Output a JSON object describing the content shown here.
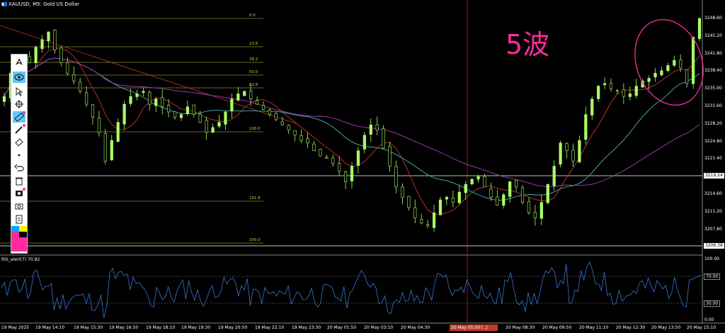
{
  "title": "XAUUSD, M5:  Gold US Dollar",
  "annotation": "5波",
  "indicator_label": "RSI_alert(7) 70.92",
  "price_axis": {
    "labels": [
      "3248.60",
      "3245.20",
      "3241.80",
      "3238.40",
      "3235.00",
      "3231.60",
      "3228.20",
      "3224.80",
      "3221.40",
      "3218.00",
      "3214.60",
      "3211.20",
      "3207.80"
    ],
    "current_price": "3219.24",
    "low_price": "3206.38"
  },
  "rsi_axis": {
    "top": "100.00",
    "upper": "70.00",
    "lower": "30.00",
    "bottom": "0.00"
  },
  "fib_levels": [
    "0.0",
    "23.6",
    "38.2",
    "50.0",
    "61.8",
    "100.0",
    "161.8",
    "200.0"
  ],
  "time_axis": [
    "19 May 2025",
    "19 May 14:10",
    "19 May 15:30",
    "19 May 16:50",
    "19 May 18:10",
    "19 May 19:30",
    "19 May 20:50",
    "19 May 22:10",
    "19 May 23:30",
    "20 May 01:50",
    "20 May 03:10",
    "20 May 04:30",
    "07:10",
    "20 May 08:30",
    "20 May 09:50",
    "20 May 11:10",
    "20 May 12:30",
    "20 May 13:50",
    "20 May 15:10"
  ],
  "time_highlight": "20 May 05:50 [..]",
  "toolbar": [
    "eye-icon",
    "cursor-icon",
    "crosshair-icon",
    "ruler-icon",
    "pencil-icon",
    "eraser-icon",
    "dot-icon",
    "undo-icon",
    "trash-icon",
    "save-icon",
    "screenshot-icon",
    "clipboard-icon"
  ],
  "colors": {
    "candle": "#aaff66",
    "ma_red": "#c0392b",
    "ma_teal": "#4fb3b3",
    "ma_purple": "#a83cbf",
    "fib": "#d8c44a",
    "rsi": "#3a78d0",
    "annotation": "#ff2a9d",
    "vline": "#cc2222"
  },
  "chart_data": {
    "type": "candlestick",
    "instrument": "XAUUSD",
    "timeframe": "M5",
    "current_price": 3219.24,
    "low_marker": 3206.38,
    "closes": [
      3233.5,
      3238.0,
      3239.5,
      3241.0,
      3240.0,
      3243.0,
      3244.5,
      3246.0,
      3242.5,
      3240.0,
      3238.0,
      3236.5,
      3234.5,
      3232.0,
      3229.5,
      3226.5,
      3221.0,
      3225.0,
      3228.5,
      3232.0,
      3233.5,
      3234.0,
      3234.5,
      3232.0,
      3233.0,
      3231.5,
      3230.5,
      3229.5,
      3230.0,
      3231.5,
      3230.0,
      3228.5,
      3226.5,
      3227.5,
      3228.5,
      3230.5,
      3233.0,
      3234.0,
      3234.5,
      3233.0,
      3232.0,
      3231.0,
      3230.0,
      3229.0,
      3228.0,
      3227.0,
      3226.0,
      3225.0,
      3224.5,
      3223.0,
      3222.0,
      3221.5,
      3220.5,
      3219.0,
      3217.0,
      3220.0,
      3223.0,
      3226.0,
      3228.0,
      3227.0,
      3223.5,
      3220.0,
      3216.0,
      3214.0,
      3212.0,
      3210.0,
      3209.0,
      3208.5,
      3211.0,
      3213.5,
      3214.0,
      3213.0,
      3215.0,
      3216.5,
      3217.5,
      3218.0,
      3216.0,
      3214.0,
      3212.5,
      3214.5,
      3217.0,
      3216.0,
      3213.0,
      3211.0,
      3210.0,
      3213.0,
      3216.5,
      3220.0,
      3224.5,
      3223.0,
      3221.0,
      3225.0,
      3230.0,
      3233.0,
      3235.5,
      3236.0,
      3235.0,
      3234.5,
      3233.5,
      3234.0,
      3235.5,
      3236.5,
      3237.0,
      3238.0,
      3238.5,
      3239.5,
      3240.5,
      3239.0,
      3236.0,
      3245.0,
      3248.6
    ]
  }
}
